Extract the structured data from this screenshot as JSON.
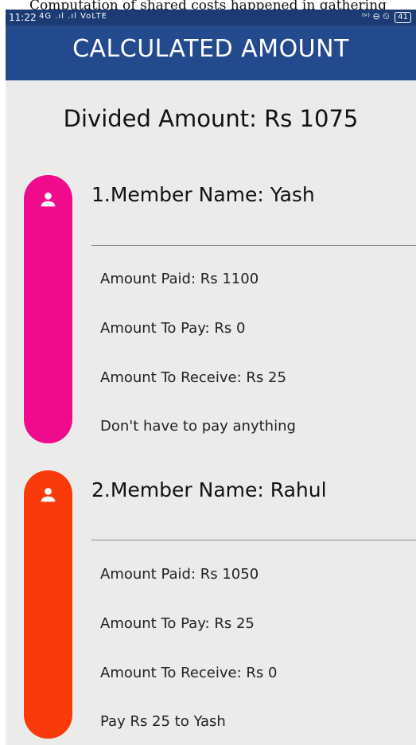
{
  "caption": "Computation of shared costs happened in gathering",
  "status_bar": {
    "time": "11:22",
    "signal": "4G .ıl .ıl VoLTE",
    "right_icons": "⁽ᵛ⁾ ⊖ ⏲",
    "battery": "41"
  },
  "app_bar": {
    "title": "CALCULATED AMOUNT"
  },
  "divided_amount": "Divided Amount: Rs 1075",
  "members": [
    {
      "name": "1.Member Name: Yash",
      "color": "#f00a8c",
      "amount_paid": "Amount Paid: Rs 1100",
      "amount_to_pay": "Amount To Pay: Rs 0",
      "amount_to_receive": "Amount To Receive: Rs 25",
      "status": "Don't have to pay anything"
    },
    {
      "name": "2.Member Name: Rahul",
      "color": "#fa3a0a",
      "amount_paid": "Amount Paid: Rs 1050",
      "amount_to_pay": "Amount To Pay: Rs 25",
      "amount_to_receive": "Amount To Receive: Rs 0",
      "status": "Pay Rs 25 to Yash"
    }
  ]
}
